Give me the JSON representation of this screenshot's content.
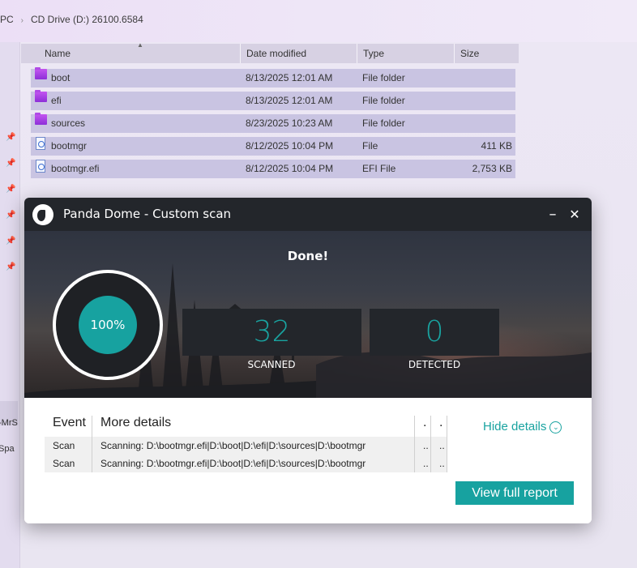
{
  "explorer": {
    "breadcrumb": [
      "PC",
      "CD Drive (D:) 26100.6584"
    ],
    "columns": [
      "Name",
      "Date modified",
      "Type",
      "Size"
    ],
    "files": [
      {
        "name": "boot",
        "date": "8/13/2025 12:01 AM",
        "type": "File folder",
        "size": "",
        "icon": "folder-icon"
      },
      {
        "name": "efi",
        "date": "8/13/2025 12:01 AM",
        "type": "File folder",
        "size": "",
        "icon": "folder-icon"
      },
      {
        "name": "sources",
        "date": "8/23/2025 10:23 AM",
        "type": "File folder",
        "size": "",
        "icon": "folder-icon"
      },
      {
        "name": "bootmgr",
        "date": "8/12/2025 10:04 PM",
        "type": "File",
        "size": "411 KB",
        "icon": "system-file-icon"
      },
      {
        "name": "bootmgr.efi",
        "date": "8/12/2025 10:04 PM",
        "type": "EFI File",
        "size": "2,753 KB",
        "icon": "system-file-icon"
      }
    ],
    "nav_hints": [
      "-MrS",
      "Spa"
    ]
  },
  "dialog": {
    "title": "Panda Dome - Custom scan",
    "minimize": "–",
    "close": "✕",
    "status": "Done!",
    "progress": "100%",
    "progress_fraction": 1.0,
    "scanned_count": "32",
    "scanned_label": "SCANNED",
    "detected_count": "0",
    "detected_label": "DETECTED",
    "table": {
      "headers": [
        "Event",
        "More details",
        ".",
        "."
      ],
      "rows": [
        [
          "Scan",
          "Scanning: D:\\bootmgr.efi|D:\\boot|D:\\efi|D:\\sources|D:\\bootmgr",
          "..",
          ".."
        ],
        [
          "Scan",
          "Scanning: D:\\bootmgr.efi|D:\\boot|D:\\efi|D:\\sources|D:\\bootmgr",
          "..",
          ".."
        ]
      ]
    },
    "hide_details": "Hide details",
    "view_report": "View full report"
  },
  "colors": {
    "accent": "#17a2a0",
    "titlebar": "#23262b",
    "folder": "#b04ae6"
  }
}
